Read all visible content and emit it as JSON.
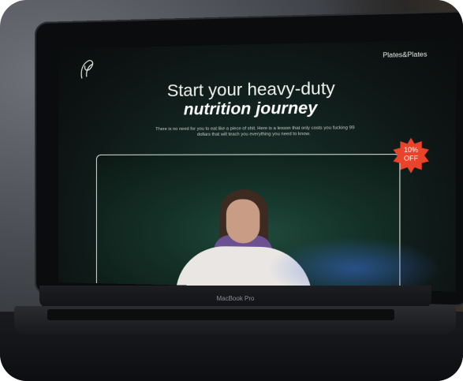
{
  "brand": {
    "name": "Plates&Plates",
    "logo_icon": "leaf-logo-icon"
  },
  "hero": {
    "title_line1": "Start your heavy-duty",
    "title_line2": "nutrition journey",
    "description": "There is no need for you to eat like a piece of shit. Here is a lesson that only costs you fucking 99 dollars that will teach you everything you need to know."
  },
  "badge": {
    "line1": "10%",
    "line2": "OFF",
    "color": "#e9432a"
  },
  "video": {
    "icon": "person-video"
  },
  "laptop": {
    "model": "MacBook Pro"
  },
  "colors": {
    "accent": "#e9432a",
    "screen_bg": "#0d1413"
  }
}
